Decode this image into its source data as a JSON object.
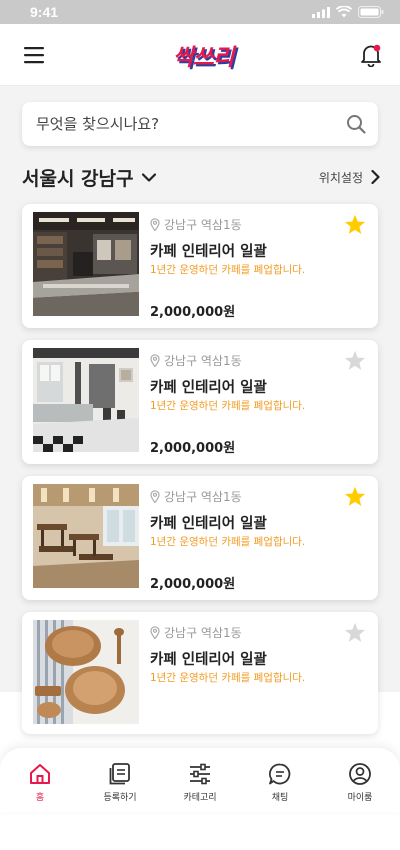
{
  "status": {
    "time": "9:41"
  },
  "header": {
    "logo_text": "싹쓰리",
    "brand_color": "#e8184d",
    "logo_shadow_color": "#2a3f9e",
    "menu_icon": "hamburger-icon",
    "bell_icon": "bell-icon",
    "notification_dot_color": "#e8184d"
  },
  "search": {
    "placeholder": "무엇을 찾으시나요?",
    "value": "",
    "icon": "search-icon"
  },
  "location": {
    "title": "서울시 강남구",
    "settings_label": "위치설정"
  },
  "listings": [
    {
      "location": "강남구 역삼1동",
      "title": "카페 인테리어 일괄",
      "description": "1년간 운영하던 카페를 폐업합니다.",
      "price": "2,000,000원",
      "favorited": true
    },
    {
      "location": "강남구 역삼1동",
      "title": "카페 인테리어 일괄",
      "description": "1년간 운영하던 카페를 폐업합니다.",
      "price": "2,000,000원",
      "favorited": false
    },
    {
      "location": "강남구 역삼1동",
      "title": "카페 인테리어 일괄",
      "description": "1년간 운영하던 카페를 폐업합니다.",
      "price": "2,000,000원",
      "favorited": true
    },
    {
      "location": "강남구 역삼1동",
      "title": "카페 인테리어 일괄",
      "description": "1년간 운영하던 카페를 폐업합니다.",
      "price": "",
      "favorited": false
    }
  ],
  "colors": {
    "accent": "#e8184d",
    "description_text": "#f39a1f",
    "star_active": "#ffcc00",
    "star_inactive": "#d8d8d8"
  },
  "nav": {
    "active_index": 0,
    "items": [
      {
        "label": "홈",
        "icon": "home-icon"
      },
      {
        "label": "등록하기",
        "icon": "register-icon"
      },
      {
        "label": "카테고리",
        "icon": "category-icon"
      },
      {
        "label": "채팅",
        "icon": "chat-icon"
      },
      {
        "label": "마이룸",
        "icon": "user-icon"
      }
    ]
  }
}
